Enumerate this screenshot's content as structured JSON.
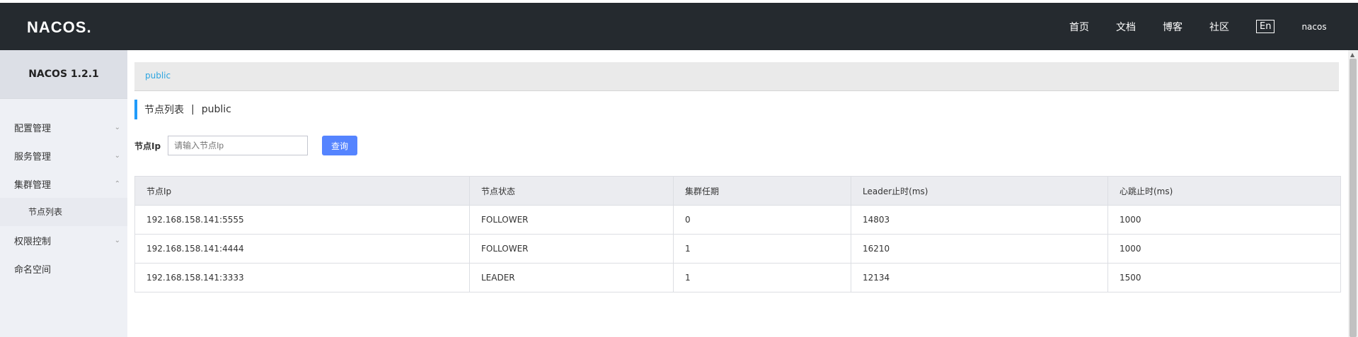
{
  "app": {
    "logo": "NACOS."
  },
  "topnav": {
    "items": [
      {
        "label": "首页"
      },
      {
        "label": "文档"
      },
      {
        "label": "博客"
      },
      {
        "label": "社区"
      }
    ],
    "lang": "En",
    "user": "nacos"
  },
  "sidebar": {
    "version": "NACOS 1.2.1",
    "items": [
      {
        "label": "配置管理",
        "chevron": "chevron-down-icon"
      },
      {
        "label": "服务管理",
        "chevron": "chevron-down-icon"
      },
      {
        "label": "集群管理",
        "chevron": "chevron-up-icon"
      }
    ],
    "submenu": [
      {
        "label": "节点列表"
      }
    ],
    "items_after": [
      {
        "label": "权限控制",
        "chevron": "chevron-down-icon"
      },
      {
        "label": "命名空间"
      }
    ]
  },
  "breadcrumb": {
    "namespace": "public"
  },
  "page": {
    "title": "节点列表",
    "sep": "|",
    "namespace": "public"
  },
  "search": {
    "label": "节点Ip",
    "placeholder": "请输入节点Ip",
    "button": "查询"
  },
  "table": {
    "headers": [
      "节点Ip",
      "节点状态",
      "集群任期",
      "Leader止时(ms)",
      "心跳止时(ms)"
    ],
    "rows": [
      [
        "192.168.158.141:5555",
        "FOLLOWER",
        "0",
        "14803",
        "1000"
      ],
      [
        "192.168.158.141:4444",
        "FOLLOWER",
        "1",
        "16210",
        "1000"
      ],
      [
        "192.168.158.141:3333",
        "LEADER",
        "1",
        "12134",
        "1500"
      ]
    ]
  },
  "colors": {
    "topbar": "#252a2f",
    "accent": "#209bfa",
    "button": "#5584ff",
    "link": "#2da5e0"
  }
}
